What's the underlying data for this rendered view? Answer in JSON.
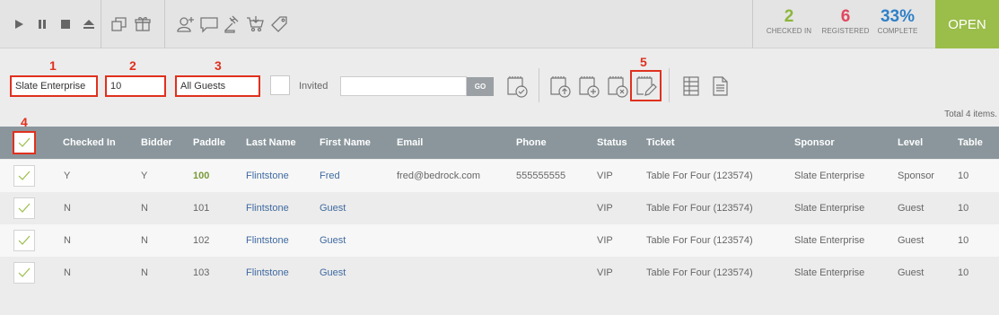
{
  "topbar": {
    "stats": {
      "checked_in": {
        "value": "2",
        "label": "CHECKED IN",
        "color": "#8db63c"
      },
      "registered": {
        "value": "6",
        "label": "REGISTERED",
        "color": "#e0485f"
      },
      "complete": {
        "value": "33%",
        "label": "COMPLETE",
        "color": "#2f80c8"
      }
    },
    "open_label": "OPEN"
  },
  "filters": {
    "sponsor": "Slate Enterprise",
    "table": "10",
    "guests": "All Guests",
    "invited_label": "Invited",
    "search_value": "",
    "go_label": "GO"
  },
  "badges": {
    "b1": "1",
    "b2": "2",
    "b3": "3",
    "b4": "4",
    "b5": "5"
  },
  "total_text": "Total 4 items.",
  "columns": {
    "checked_in": "Checked In",
    "bidder": "Bidder",
    "paddle": "Paddle",
    "last_name": "Last Name",
    "first_name": "First Name",
    "email": "Email",
    "phone": "Phone",
    "status": "Status",
    "ticket": "Ticket",
    "sponsor": "Sponsor",
    "level": "Level",
    "table": "Table"
  },
  "rows": [
    {
      "checked_in": "Y",
      "bidder": "Y",
      "paddle": "100",
      "last_name": "Flintstone",
      "first_name": "Fred",
      "email": "fred@bedrock.com",
      "phone": "555555555",
      "status": "VIP",
      "ticket": "Table For Four (123574)",
      "sponsor": "Slate Enterprise",
      "level": "Sponsor",
      "table": "10"
    },
    {
      "checked_in": "N",
      "bidder": "N",
      "paddle": "101",
      "last_name": "Flintstone",
      "first_name": "Guest",
      "email": "",
      "phone": "",
      "status": "VIP",
      "ticket": "Table For Four (123574)",
      "sponsor": "Slate Enterprise",
      "level": "Guest",
      "table": "10"
    },
    {
      "checked_in": "N",
      "bidder": "N",
      "paddle": "102",
      "last_name": "Flintstone",
      "first_name": "Guest",
      "email": "",
      "phone": "",
      "status": "VIP",
      "ticket": "Table For Four (123574)",
      "sponsor": "Slate Enterprise",
      "level": "Guest",
      "table": "10"
    },
    {
      "checked_in": "N",
      "bidder": "N",
      "paddle": "103",
      "last_name": "Flintstone",
      "first_name": "Guest",
      "email": "",
      "phone": "",
      "status": "VIP",
      "ticket": "Table For Four (123574)",
      "sponsor": "Slate Enterprise",
      "level": "Guest",
      "table": "10"
    }
  ]
}
